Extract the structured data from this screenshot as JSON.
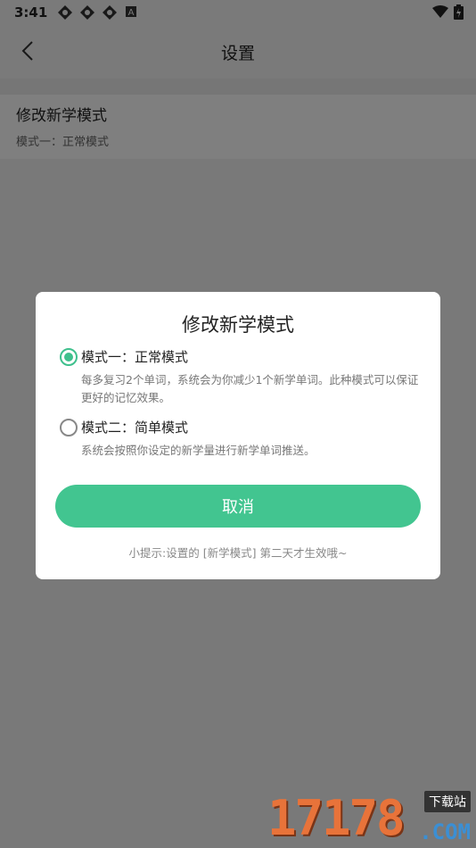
{
  "status_bar": {
    "time": "3:41",
    "icons": [
      "app-notification-icon",
      "app-notification-icon",
      "app-notification-icon",
      "a-letter-icon",
      "wifi-icon",
      "battery-icon"
    ]
  },
  "app_bar": {
    "title": "设置",
    "back_icon": "chevron-left-icon"
  },
  "settings": [
    {
      "title": "修改新学模式",
      "subtitle": "模式一：正常模式"
    }
  ],
  "dialog": {
    "title": "修改新学模式",
    "options": [
      {
        "label": "模式一：正常模式",
        "description": "每多复习2个单词，系统会为你减少1个新学单词。此种模式可以保证更好的记忆效果。",
        "checked": true
      },
      {
        "label": "模式二：简单模式",
        "description": "系统会按照你设定的新学量进行新学单词推送。",
        "checked": false
      }
    ],
    "cancel_label": "取消",
    "tip": "小提示:设置的 [新学模式] 第二天才生效哦~"
  },
  "watermark": {
    "digits": "17178",
    "tag": "下载站",
    "domain": ".COM"
  },
  "colors": {
    "accent": "#42c590",
    "overlay": "rgba(0,0,0,0.5)"
  }
}
